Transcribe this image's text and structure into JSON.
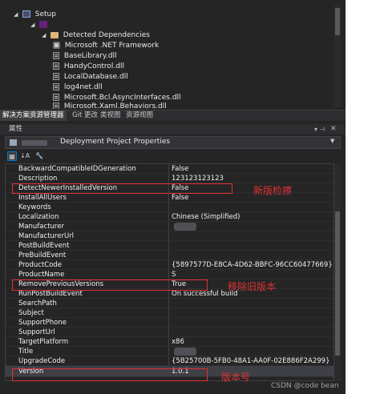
{
  "solution_tree": {
    "setup_label": "Setup",
    "detected_dependencies_label": "Detected Dependencies",
    "dependencies": [
      "Microsoft .NET Framework",
      "BaseLibrary.dll",
      "HandyControl.dll",
      "LocalDatabase.dll",
      "log4net.dll",
      "Microsoft.Bcl.AsyncInterfaces.dll",
      "Microsoft.Xaml.Behaviors.dll"
    ]
  },
  "tabs": [
    "解决方案资源管理器",
    "Git 更改",
    "类视图",
    "资源视图"
  ],
  "properties_panel": {
    "title": "属性",
    "selector_text": "Deployment Project Properties",
    "toolbar": [
      "categorized-icon",
      "alphabetical-icon",
      "property-pages-icon"
    ],
    "rows": [
      {
        "name": "BackwardCompatibleIDGeneration",
        "value": "False"
      },
      {
        "name": "Description",
        "value": "123123123123"
      },
      {
        "name": "DetectNewerInstalledVersion",
        "value": "False"
      },
      {
        "name": "InstallAllUsers",
        "value": "False"
      },
      {
        "name": "Keywords",
        "value": ""
      },
      {
        "name": "Localization",
        "value": "Chinese (Simplified)"
      },
      {
        "name": "Manufacturer",
        "value": ""
      },
      {
        "name": "ManufacturerUrl",
        "value": ""
      },
      {
        "name": "PostBuildEvent",
        "value": ""
      },
      {
        "name": "PreBuildEvent",
        "value": ""
      },
      {
        "name": "ProductCode",
        "value": "{5897577D-E8CA-4D62-BBFC-96CC60477669}"
      },
      {
        "name": "ProductName",
        "value": "S"
      },
      {
        "name": "RemovePreviousVersions",
        "value": "True"
      },
      {
        "name": "RunPostBuildEvent",
        "value": "On successful build"
      },
      {
        "name": "SearchPath",
        "value": ""
      },
      {
        "name": "Subject",
        "value": ""
      },
      {
        "name": "SupportPhone",
        "value": ""
      },
      {
        "name": "SupportUrl",
        "value": ""
      },
      {
        "name": "TargetPlatform",
        "value": "x86"
      },
      {
        "name": "Title",
        "value": ""
      },
      {
        "name": "UpgradeCode",
        "value": "{5B25700B-5FB0-48A1-AA0F-02E886F2A299}"
      },
      {
        "name": "Version",
        "value": "1.0.1"
      }
    ]
  },
  "annotations": {
    "detect": "新版检擦",
    "remove": "移除旧版本",
    "version": "版本号"
  },
  "colors": {
    "highlight": "#e03131",
    "accent": "#007acc"
  },
  "watermark": "CSDN @code bean"
}
